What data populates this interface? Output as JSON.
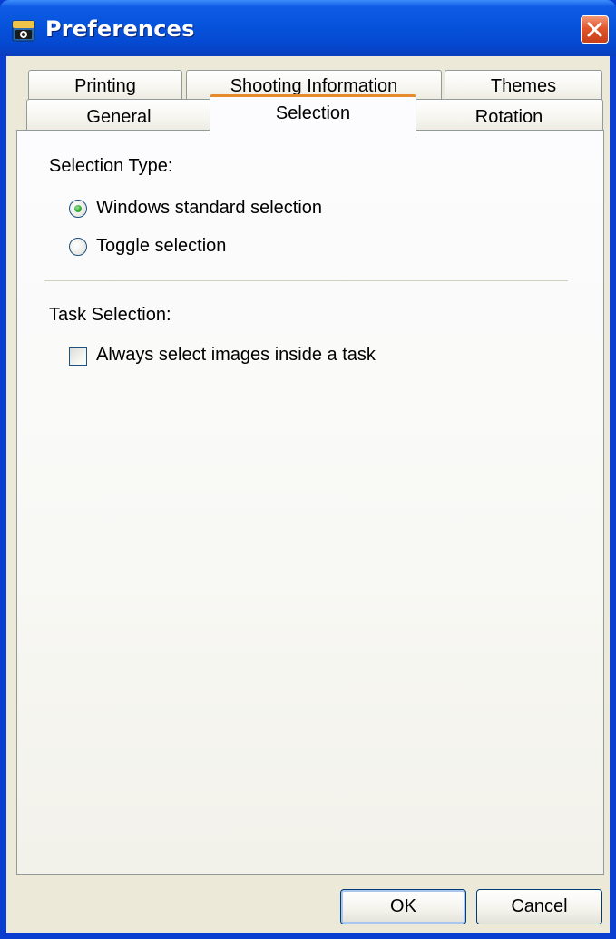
{
  "window": {
    "title": "Preferences",
    "icon": "camera-app-icon",
    "close_icon": "close-icon"
  },
  "tabs": {
    "back_row": [
      {
        "label": "Printing"
      },
      {
        "label": "Shooting Information"
      },
      {
        "label": "Themes"
      }
    ],
    "front_row": [
      {
        "label": "General"
      },
      {
        "label": "Selection",
        "active": true
      },
      {
        "label": "Rotation"
      }
    ]
  },
  "selection_type": {
    "heading": "Selection Type:",
    "options": [
      {
        "label": "Windows standard selection",
        "selected": true
      },
      {
        "label": "Toggle selection",
        "selected": false
      }
    ]
  },
  "task_selection": {
    "heading": "Task Selection:",
    "checkbox_label": "Always select images inside a task",
    "checked": false
  },
  "buttons": {
    "ok": "OK",
    "cancel": "Cancel"
  },
  "colors": {
    "titlebar": "#0653dc",
    "active_tab_accent": "#e68b2c",
    "close_button": "#e2552c",
    "radio_dot": "#21a121"
  }
}
